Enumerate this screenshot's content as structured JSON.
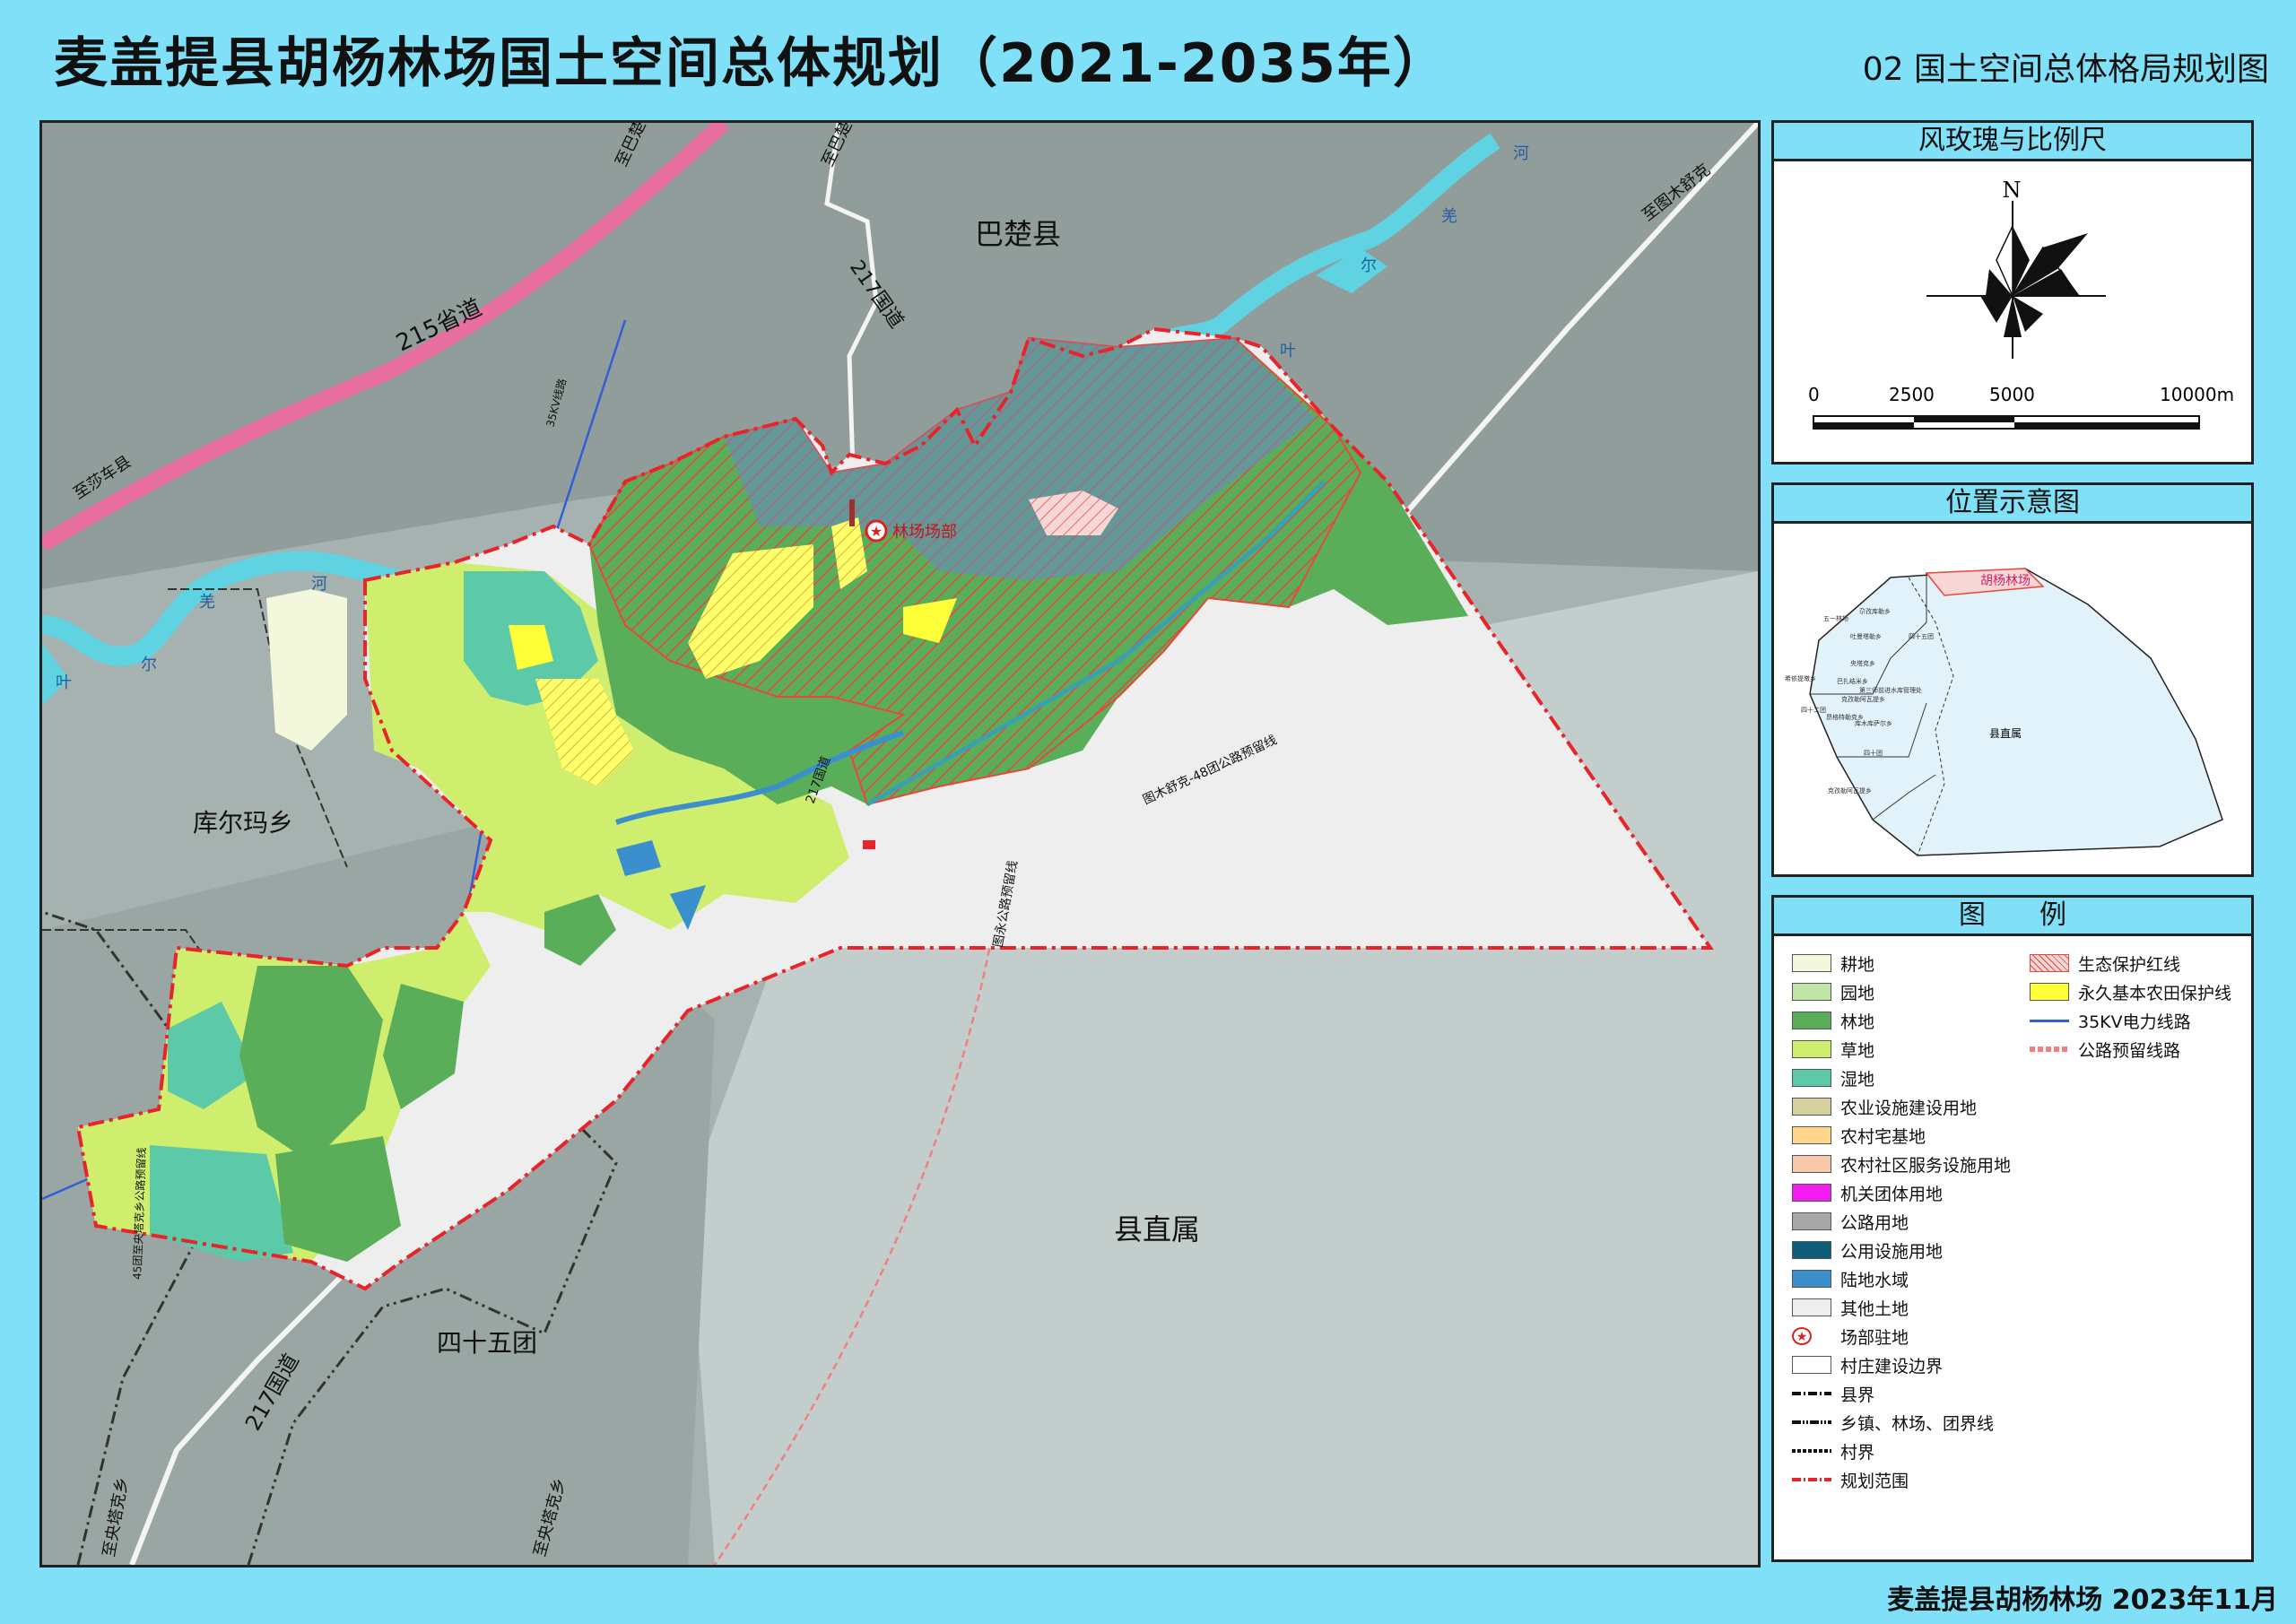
{
  "header": {
    "title": "麦盖提县胡杨林场国土空间总体规划（2021-2035年）",
    "subtitle": "02 国土空间总体格局规划图"
  },
  "footer": {
    "text": "麦盖提县胡杨林场 2023年11月"
  },
  "map": {
    "labels": {
      "bachu": "巴楚县",
      "kuerma": "库尔玛乡",
      "xianzhishu": "县直属",
      "sishiwutuan": "四十五团",
      "hq": "林场场部",
      "zhi_bachu1": "至巴楚",
      "zhi_bachu2": "至巴楚",
      "zhi_shache": "至莎车县",
      "zhi_tumushuke": "至图木舒克",
      "zhi_yangta": "至央塔克乡",
      "zhi_yangta2": "至央塔克乡",
      "road_215": "215省道",
      "road_217": "217国道",
      "road_217b": "217国道",
      "road_217c": "217国道",
      "line_35kv": "35KV线路",
      "reserve_1": "图木舒克-48团公路预留线",
      "reserve_2": "图永公路预留线",
      "reserve_3": "45团至央塔克乡公路预留线",
      "river_ye": "叶",
      "river_er": "尔",
      "river_qiang": "羌",
      "river_he": "河",
      "river_ye2": "叶",
      "river_er2": "尔",
      "river_qiang2": "羌",
      "river_he2": "河"
    }
  },
  "compass_panel": {
    "title": "风玫瑰与比例尺",
    "north": "N",
    "scale": [
      "0",
      "2500",
      "5000",
      "10000m"
    ]
  },
  "location_panel": {
    "title": "位置示意图",
    "highlight": "胡杨林场",
    "county": "县直属",
    "places": [
      "五一林场",
      "尕孜库勒乡",
      "吐曼塔勒乡",
      "四十五团",
      "央塔克乡",
      "希依提墩乡",
      "巴扎结米乡",
      "第三师前进水库管理处",
      "克孜勒阿瓦提乡",
      "四十二团",
      "昂格特勒克乡",
      "库木库萨尔乡",
      "四十团",
      "克孜勒阿瓦提乡"
    ]
  },
  "legend": {
    "title": "图　　例",
    "left": [
      {
        "label": "耕地",
        "color": "#f3f7dc"
      },
      {
        "label": "园地",
        "color": "#bfe6a6"
      },
      {
        "label": "林地",
        "color": "#5aae5a"
      },
      {
        "label": "草地",
        "color": "#cfee6e"
      },
      {
        "label": "湿地",
        "color": "#5ccaa8"
      },
      {
        "label": "农业设施建设用地",
        "color": "#d6cf9e"
      },
      {
        "label": "农村宅基地",
        "color": "#ffd68a"
      },
      {
        "label": "农村社区服务设施用地",
        "color": "#f8c9a8"
      },
      {
        "label": "机关团体用地",
        "color": "#f21cf0"
      },
      {
        "label": "公路用地",
        "color": "#a8a8a8"
      },
      {
        "label": "公用设施用地",
        "color": "#0d5c78"
      },
      {
        "label": "陆地水域",
        "color": "#3a8fcc"
      },
      {
        "label": "其他土地",
        "color": "#eeeeee"
      },
      {
        "label": "场部驻地",
        "color": "#ffffff"
      },
      {
        "label": "村庄建设边界",
        "color": "#ffffff"
      },
      {
        "label": "县界",
        "color": "#ffffff"
      },
      {
        "label": "乡镇、林场、团界线",
        "color": "#ffffff"
      },
      {
        "label": "村界",
        "color": "#ffffff"
      },
      {
        "label": "规划范围",
        "color": "#ffffff"
      }
    ],
    "right": [
      {
        "label": "生态保护红线",
        "color": "#f7d6d6"
      },
      {
        "label": "永久基本农田保护线",
        "color": "#ffff3a"
      },
      {
        "label": "35KV电力线路",
        "color": "#ffffff"
      },
      {
        "label": "公路预留线路",
        "color": "#ffffff"
      }
    ]
  }
}
